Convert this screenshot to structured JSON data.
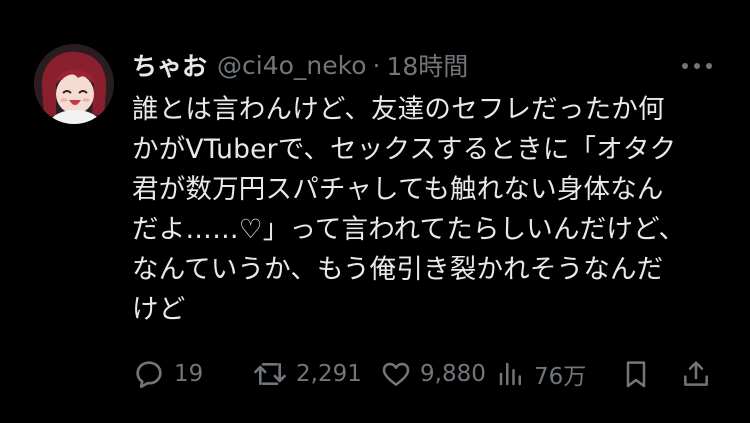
{
  "user": {
    "display_name": "ちゃお",
    "handle": "@ci4o_neko",
    "separator": "·",
    "time": "18時間",
    "avatar_caption": "ちゃお"
  },
  "tweet": {
    "lines": [
      "誰とは言わんけど、友達のセフレだったか何",
      "かがVTuberで、セックスするときに「オタク",
      "君が数万円スパチャしても触れない身体なん",
      "だよ……♡」って言われてたらしいんだけど、",
      "なんていうか、もう俺引き裂かれそうなんだ",
      "けど"
    ]
  },
  "actions": {
    "reply_count": "19",
    "repost_count": "2,291",
    "like_count": "9,880",
    "views_count": "76万"
  },
  "colors": {
    "background": "#000000",
    "primary_text": "#e7e9ea",
    "secondary_text": "#71767b",
    "icon": "#71767b"
  },
  "icons": {
    "more": "more-icon",
    "reply": "reply-icon",
    "repost": "repost-icon",
    "like": "like-icon",
    "views": "views-icon",
    "bookmark": "bookmark-icon",
    "share": "share-icon"
  }
}
